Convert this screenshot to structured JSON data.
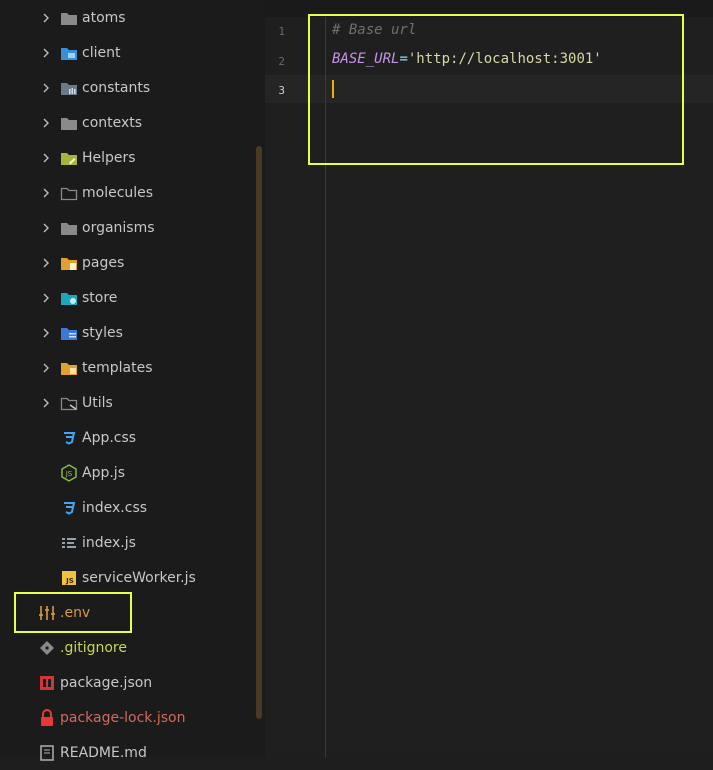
{
  "explorer": {
    "folders": [
      {
        "label": "atoms",
        "icon": "folder-icon"
      },
      {
        "label": "client",
        "icon": "folder-client-icon"
      },
      {
        "label": "constants",
        "icon": "folder-constants-icon"
      },
      {
        "label": "contexts",
        "icon": "folder-icon"
      },
      {
        "label": "Helpers",
        "icon": "folder-helpers-icon"
      },
      {
        "label": "molecules",
        "icon": "folder-outline-icon"
      },
      {
        "label": "organisms",
        "icon": "folder-icon"
      },
      {
        "label": "pages",
        "icon": "folder-pages-icon"
      },
      {
        "label": "store",
        "icon": "folder-store-icon"
      },
      {
        "label": "styles",
        "icon": "folder-styles-icon"
      },
      {
        "label": "templates",
        "icon": "folder-templates-icon"
      },
      {
        "label": "Utils",
        "icon": "folder-utils-icon"
      }
    ],
    "src_files": [
      {
        "label": "App.css",
        "icon": "css-icon"
      },
      {
        "label": "App.js",
        "icon": "nodejs-icon"
      },
      {
        "label": "index.css",
        "icon": "css-icon"
      },
      {
        "label": "index.js",
        "icon": "list-icon"
      },
      {
        "label": "serviceWorker.js",
        "icon": "js-icon"
      }
    ],
    "root_files": [
      {
        "label": ".env",
        "icon": "env-settings-icon",
        "color": "#d79a45"
      },
      {
        "label": ".gitignore",
        "icon": "git-icon",
        "color": "#c8d84a"
      },
      {
        "label": "package.json",
        "icon": "npm-icon",
        "color": "#c7c7c7"
      },
      {
        "label": "package-lock.json",
        "icon": "lock-icon",
        "color": "#d06a5a"
      },
      {
        "label": "README.md",
        "icon": "book-icon",
        "color": "#c7c7c7"
      }
    ]
  },
  "editor": {
    "line_numbers": [
      "1",
      "2",
      "3"
    ],
    "comment": "# Base url",
    "var_name": "BASE_URL",
    "equals": "=",
    "value": "'http://localhost:3001'"
  },
  "colors": {
    "highlight": "#e5ff4a",
    "caret": "#f0b000",
    "comment": "#6f6f6f",
    "keyword": "#c792ea",
    "string": "#d7d7a8"
  }
}
